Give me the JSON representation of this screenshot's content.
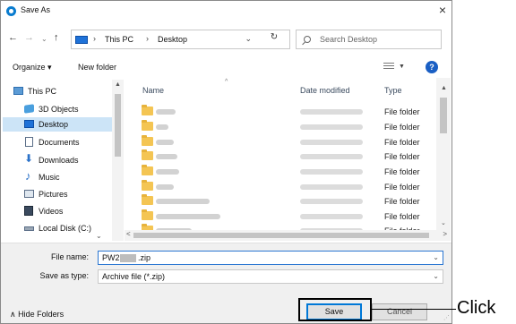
{
  "window": {
    "title": "Save As",
    "close": "×"
  },
  "nav": {
    "back": "←",
    "forward": "→",
    "recent": "⌄",
    "up": "↑",
    "address": [
      "This PC",
      "Desktop"
    ],
    "separator": "›",
    "refresh": "↻",
    "search_placeholder": "Search Desktop"
  },
  "toolbar": {
    "organize": "Organize ▾",
    "new_folder": "New folder",
    "help": "?"
  },
  "nav_pane": [
    {
      "label": "This PC",
      "icon": "monitor-icon",
      "selected": false
    },
    {
      "label": "3D Objects",
      "icon": "cube-icon",
      "selected": false
    },
    {
      "label": "Desktop",
      "icon": "desktop-icon",
      "selected": true
    },
    {
      "label": "Documents",
      "icon": "document-icon",
      "selected": false
    },
    {
      "label": "Downloads",
      "icon": "download-icon",
      "selected": false
    },
    {
      "label": "Music",
      "icon": "music-icon",
      "selected": false
    },
    {
      "label": "Pictures",
      "icon": "picture-icon",
      "selected": false
    },
    {
      "label": "Videos",
      "icon": "video-icon",
      "selected": false
    },
    {
      "label": "Local Disk (C:)",
      "icon": "disk-icon",
      "selected": false
    }
  ],
  "file_list": {
    "columns": [
      "Name",
      "Date modified",
      "Type"
    ],
    "rows": [
      {
        "type": "File folder"
      },
      {
        "type": "File folder"
      },
      {
        "type": "File folder"
      },
      {
        "type": "File folder"
      },
      {
        "type": "File folder"
      },
      {
        "type": "File folder"
      },
      {
        "type": "File folder"
      },
      {
        "type": "File folder"
      },
      {
        "type": "File folder"
      }
    ]
  },
  "form": {
    "file_name_label": "File name:",
    "file_name_prefix": "PW2",
    "file_name_suffix": ".zip",
    "save_type_label": "Save as type:",
    "save_type_value": "Archive file (*.zip)",
    "hide_folders": "∧  Hide Folders",
    "save": "Save",
    "cancel": "Cancel"
  },
  "annotation": {
    "label": "Click",
    "color": "#000000"
  },
  "colors": {
    "accent": "#0078d7",
    "selected_bg": "#cce4f7",
    "folder": "#f4c553"
  }
}
